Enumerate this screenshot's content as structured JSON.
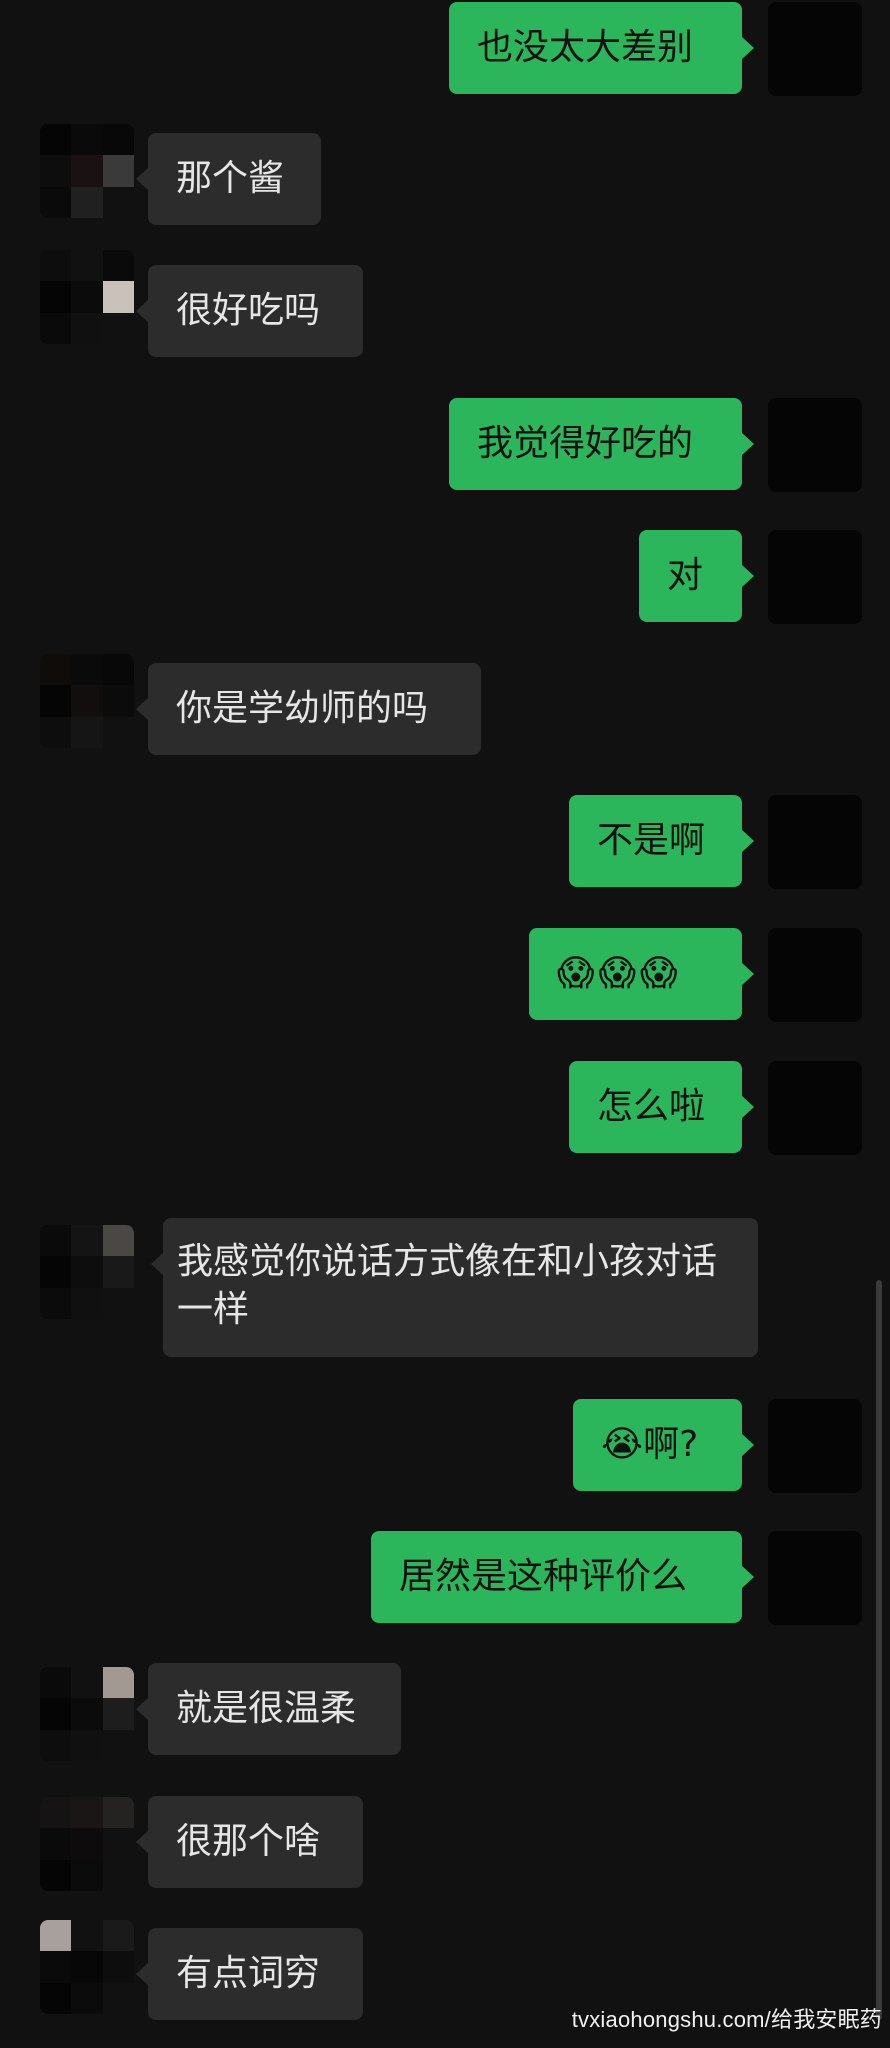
{
  "messages": [
    {
      "from": "me",
      "text": "也没太大差别"
    },
    {
      "from": "other",
      "text": "那个酱"
    },
    {
      "from": "other",
      "text": "很好吃吗"
    },
    {
      "from": "me",
      "text": "我觉得好吃的"
    },
    {
      "from": "me",
      "text": "对"
    },
    {
      "from": "other",
      "text": "你是学幼师的吗"
    },
    {
      "from": "me",
      "text": "不是啊"
    },
    {
      "from": "me",
      "text": "😱😱😱"
    },
    {
      "from": "me",
      "text": "怎么啦"
    },
    {
      "from": "other",
      "text": "我感觉你说话方式像在和小孩对话一样"
    },
    {
      "from": "me",
      "text": "😭啊?"
    },
    {
      "from": "me",
      "text": "居然是这种评价么"
    },
    {
      "from": "other",
      "text": "就是很温柔"
    },
    {
      "from": "other",
      "text": "很那个啥"
    },
    {
      "from": "other",
      "text": "有点词穷"
    }
  ],
  "watermark": "tvxiaohongshu.com/给我安眠药",
  "colors": {
    "background": "#111111",
    "outgoing_bubble": "#2bb65c",
    "incoming_bubble": "#2c2c2c"
  }
}
